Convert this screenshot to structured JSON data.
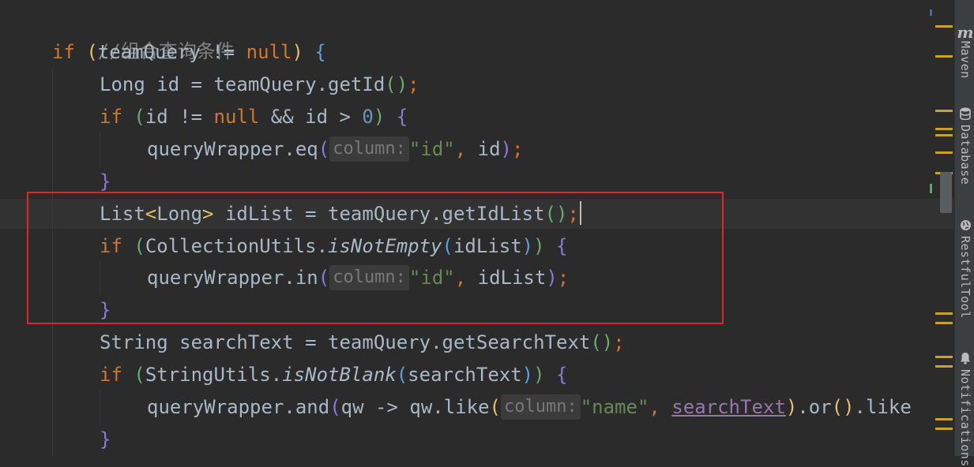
{
  "editor": {
    "comment": "//组合查询条件",
    "kw_if": "if",
    "kw_null": "null",
    "var_teamQuery": "teamQuery",
    "var_id": "id",
    "var_idList": "idList",
    "var_searchText": "searchText",
    "var_qw": "qw",
    "var_queryWrapper": "queryWrapper",
    "type_Long": "Long",
    "type_List": "List",
    "type_String": "String",
    "cls_CollectionUtils": "CollectionUtils",
    "cls_StringUtils": "StringUtils",
    "m_getId": "getId",
    "m_getIdList": "getIdList",
    "m_getSearchText": "getSearchText",
    "m_eq": "eq",
    "m_in": "in",
    "m_and": "and",
    "m_like": "like",
    "m_or": "or",
    "m_isNotEmpty": "isNotEmpty",
    "m_isNotBlank": "isNotBlank",
    "op_neq": "!=",
    "op_and": "&&",
    "op_gt": ">",
    "op_eq": "=",
    "op_arrow": "->",
    "num_zero": "0",
    "str_id": "\"id\"",
    "str_name": "\"name\"",
    "hint_column": "column:"
  },
  "tool_windows": [
    {
      "label": "Maven",
      "icon": "maven-icon"
    },
    {
      "label": "Database",
      "icon": "database-icon"
    },
    {
      "label": "RestfulTool",
      "icon": "globe-icon"
    },
    {
      "label": "Notifications",
      "icon": "bell-icon"
    }
  ],
  "colors": {
    "background": "#2b2b2b",
    "keyword": "#cc7832",
    "string": "#6a8759",
    "number": "#6897bb",
    "comment": "#808080",
    "selection_box": "#e0262d"
  }
}
